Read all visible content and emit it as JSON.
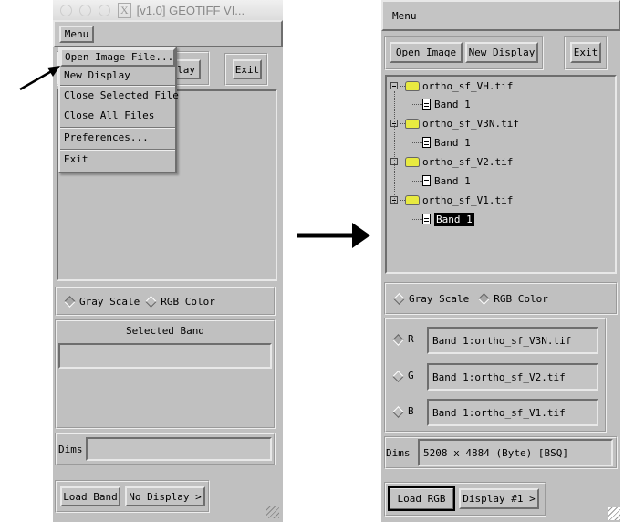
{
  "left_window": {
    "title": "[v1.0] GEOTIFF VI...",
    "title_icon": "x11-icon",
    "menu_label": "Menu",
    "menu_items": [
      "Open Image File...",
      "New Display",
      "Close Selected File",
      "Close All Files",
      "Preferences...",
      "Exit"
    ],
    "partial_button": "play",
    "exit_label": "Exit",
    "color_modes": {
      "gray": "Gray Scale",
      "rgb": "RGB Color",
      "selected": "gray"
    },
    "selected_band_label": "Selected Band",
    "selected_band_value": "",
    "dims_label": "Dims",
    "dims_value": "",
    "load_button": "Load Band",
    "display_button": "No Display >"
  },
  "right_window": {
    "menu_label": "Menu",
    "open_image": "Open Image",
    "new_display": "New Display",
    "exit_label": "Exit",
    "tree": [
      {
        "file": "ortho_sf_VH.tif",
        "band": "Band 1"
      },
      {
        "file": "ortho_sf_V3N.tif",
        "band": "Band 1"
      },
      {
        "file": "ortho_sf_V2.tif",
        "band": "Band 1"
      },
      {
        "file": "ortho_sf_V1.tif",
        "band": "Band 1",
        "selected": true
      }
    ],
    "color_modes": {
      "gray": "Gray Scale",
      "rgb": "RGB Color",
      "selected": "rgb"
    },
    "channels": [
      {
        "label": "R",
        "value": "Band 1:ortho_sf_V3N.tif",
        "selected": true
      },
      {
        "label": "G",
        "value": "Band 1:ortho_sf_V2.tif"
      },
      {
        "label": "B",
        "value": "Band 1:ortho_sf_V1.tif"
      }
    ],
    "dims_label": "Dims",
    "dims_value": "5208 x 4884 (Byte) [BSQ]",
    "load_button": "Load RGB",
    "display_button": "Display #1 >"
  }
}
